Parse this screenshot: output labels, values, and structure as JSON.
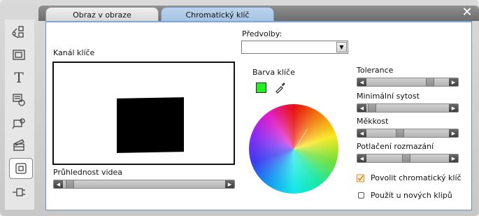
{
  "window": {
    "close_glyph": "✕"
  },
  "tabs": [
    {
      "label": "Obraz v obraze",
      "active": false
    },
    {
      "label": "Chromatický klíč",
      "active": true
    }
  ],
  "rail": {
    "icons": [
      "transitions-icon",
      "picture-in-picture-icon",
      "title-icon",
      "audio-clip-icon",
      "camera-icon",
      "clapperboard-icon",
      "chroma-key-icon",
      "plug-icon"
    ],
    "active_index": 6,
    "title_glyph": "T"
  },
  "key_channel": {
    "label": "Kanál klíče"
  },
  "video_transparency": {
    "label": "Průhlednost videa",
    "value": 0.02
  },
  "presets": {
    "label": "Předvolby:",
    "value": ""
  },
  "key_color": {
    "label": "Barva klíče",
    "color": "#22ee22"
  },
  "sliders": [
    {
      "label": "Tolerance",
      "value": 0.8
    },
    {
      "label": "Minimální sytost",
      "value": 0.02
    },
    {
      "label": "Měkkost",
      "value": 0.4
    },
    {
      "label": "Potlačení rozmazání",
      "value": 0.48
    }
  ],
  "options": [
    {
      "label": "Povolit chromatický klíč",
      "checked": true
    },
    {
      "label": "Použít u nových klipů",
      "checked": false
    }
  ],
  "colors": {
    "accent_tab": "#a3c2e3",
    "panel_border": "#6e8fb5"
  }
}
